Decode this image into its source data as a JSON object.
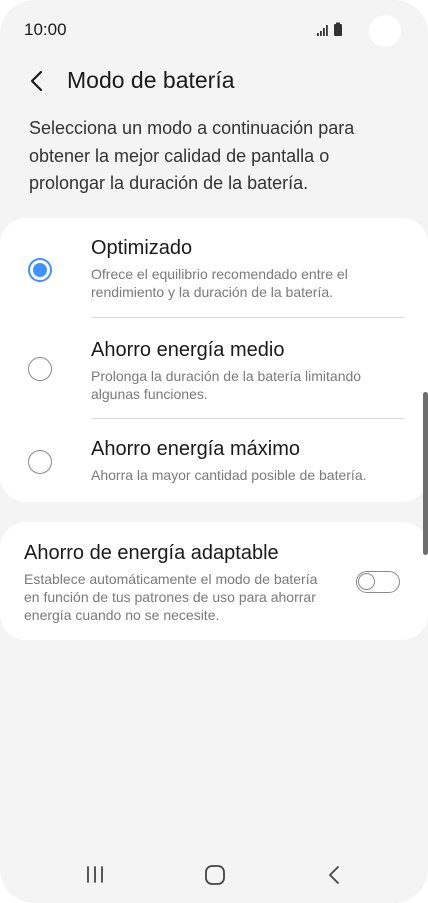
{
  "status_bar": {
    "time": "10:00",
    "icons": [
      "signal-icon",
      "battery-icon"
    ]
  },
  "header": {
    "title": "Modo de batería",
    "back_icon": "chevron-left-icon"
  },
  "description": "Selecciona un modo a continuación para obtener la mejor calidad de pantalla o prolongar la duración de la batería.",
  "modes": [
    {
      "title": "Optimizado",
      "description": "Ofrece el equilibrio recomendado entre el rendimiento y la duración de la batería.",
      "selected": true
    },
    {
      "title": "Ahorro energía medio",
      "description": "Prolonga la duración de la batería limitando algunas funciones.",
      "selected": false
    },
    {
      "title": "Ahorro energía máximo",
      "description": "Ahorra la mayor cantidad posible de batería.",
      "selected": false
    }
  ],
  "adaptive": {
    "title": "Ahorro de energía adaptable",
    "description": "Establece automáticamente el modo de batería en función de tus patrones de uso para ahorrar energía cuando no se necesite.",
    "enabled": false
  },
  "nav_bar": {
    "icons": [
      "recent-apps-icon",
      "home-icon",
      "back-icon"
    ]
  },
  "colors": {
    "background": "#f4f4f4",
    "card": "#ffffff",
    "accent": "#3e91ff",
    "text_primary": "#1a1a1a",
    "text_secondary": "#7a7a7a"
  }
}
